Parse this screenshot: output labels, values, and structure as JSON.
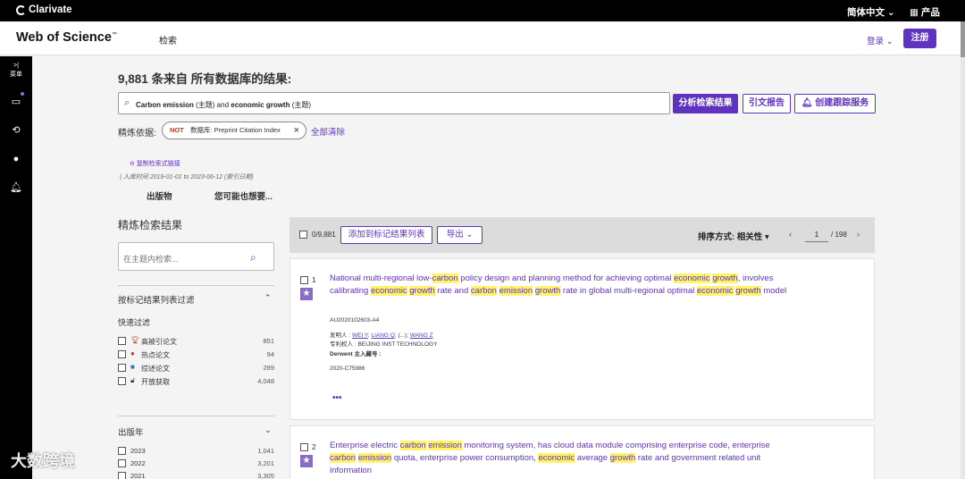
{
  "topbar": {
    "brand": "Clarivate",
    "lang": "简体中文 ⌄",
    "products": "▦ 产品"
  },
  "header": {
    "wos": "Web of Science",
    "tm": "™",
    "search_nav": "检索",
    "login": "登录 ⌄",
    "register": "注册"
  },
  "leftrail": {
    "expand": ">|",
    "menu": "菜单"
  },
  "results": {
    "title": "9,881 条来自 所有数据库的结果:"
  },
  "search": {
    "query_parts": [
      "Carbon emission",
      " (主题) and ",
      "economic growth",
      " (主题)"
    ],
    "analyze": "分析检索结果",
    "citation_report": "引文报告",
    "create_alert": "创建跟踪服务"
  },
  "refine": {
    "label": "精炼依据:",
    "chip_not": "NOT",
    "chip_text": "数据库: Preprint Citation Index",
    "clear_all": "全部清除"
  },
  "links": {
    "copy_link": "复制检索式链接",
    "index_date": "| 入库时间 2019-01-01 to 2023-06-12 (索引日期)"
  },
  "tabs": {
    "publications": "出版物",
    "maybe": "您可能也想要..."
  },
  "sidebar": {
    "title": "精炼检索结果",
    "search_placeholder": "在主题内检索...",
    "marked_filter": "按标记结果列表过滤",
    "quick_filter": "快速过滤",
    "quick_items": [
      {
        "label": "高被引论文",
        "count": "851"
      },
      {
        "label": "热点论文",
        "count": "94"
      },
      {
        "label": "综述论文",
        "count": "289"
      },
      {
        "label": "开放获取",
        "count": "4,048"
      }
    ],
    "pub_year": "出版年",
    "years": [
      {
        "label": "2023",
        "count": "1,041"
      },
      {
        "label": "2022",
        "count": "3,201"
      },
      {
        "label": "2021",
        "count": "3,305"
      }
    ]
  },
  "toolbar": {
    "selected": "0/9,881",
    "add_marked": "添加到标记结果列表",
    "export": "导出 ⌄",
    "sort": "排序方式: 相关性 ▾",
    "page": "1",
    "total_pages": "/ 198",
    "prev": "‹",
    "next": "›"
  },
  "records": [
    {
      "num": "1",
      "title_parts": [
        "National multi-regional low-",
        "carbon",
        " policy design and planning method for achieving optimal ",
        "economic",
        " ",
        "growth",
        ", involves calibrating ",
        "economic",
        " ",
        "growth",
        " rate and ",
        "carbon",
        " ",
        "emission",
        " ",
        "growth",
        " rate in global multi-regional optimal ",
        "economic",
        " ",
        "growth",
        " model"
      ],
      "patent_no": "AU2020102603-A4",
      "inventor_label": "发明人 :",
      "inventors": [
        "WEI Y",
        "LIANG Q",
        "(...)",
        "WANG Z"
      ],
      "assignee_label": "专利权人 :",
      "assignee": "BEIJING INST TECHNOLOGY",
      "derwent_label": "Derwent 主入藏号 :",
      "derwent_no": "2020-C75986",
      "more": "•••"
    },
    {
      "num": "2",
      "title_parts": [
        "Enterprise electric ",
        "carbon",
        " ",
        "emission",
        " monitoring system, has cloud data module comprising enterprise code, enterprise ",
        "carbon",
        " ",
        "emission",
        " quota, enterprise power consumption, ",
        "economic",
        " average ",
        "growth",
        " rate and government related unit information"
      ]
    }
  ],
  "watermark": "大数跨境"
}
